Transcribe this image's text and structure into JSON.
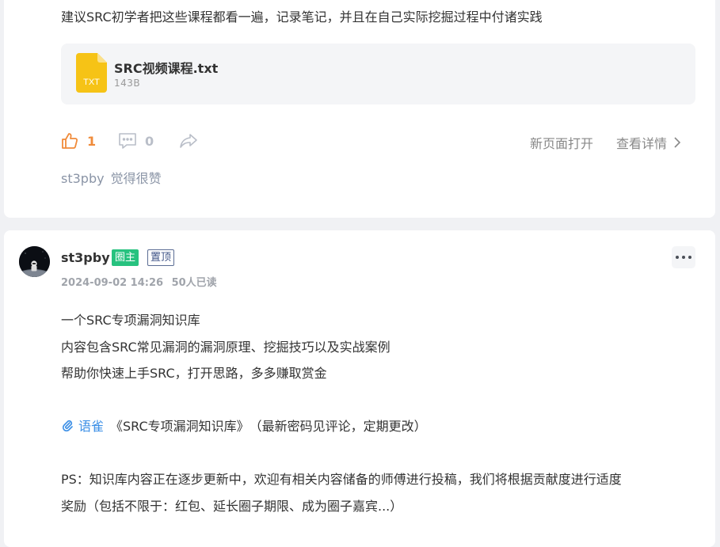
{
  "post1": {
    "text": "建议SRC初学者把这些课程都看一遍，记录笔记，并且在自己实际挖掘过程中付诸实践",
    "attachment": {
      "icon_label": "TXT",
      "name": "SRC视频课程.txt",
      "size": "143B",
      "icon": "txt-file-icon"
    },
    "likes": "1",
    "comments": "0",
    "open_new_page": "新页面打开",
    "view_details": "查看详情",
    "liker_name": "st3pby",
    "liker_text": "觉得很赞",
    "colors": {
      "like": "#f08b3a",
      "comment": "#b9bec8"
    }
  },
  "post2": {
    "author": "st3pby",
    "badge_owner": "圈主",
    "badge_pinned": "置顶",
    "datetime": "2024-09-02 14:26",
    "reads": "50人已读",
    "lines": [
      "一个SRC专项漏洞知识库",
      "内容包含SRC常见漏洞的漏洞原理、挖掘技巧以及实战案例",
      "帮助你快速上手SRC，打开思路，多多赚取赏金"
    ],
    "link_word": "语雀",
    "link_rest": "《SRC专项漏洞知识库》　（最新密码见评论，定期更改）",
    "ps_line1": "PS：知识库内容正在逐步更新中，欢迎有相关内容储备的师傅进行投稿，我们将根据贡献度进行适度",
    "ps_line2": "奖励（包括不限于：红包、延长圈子期限、成为圈子嘉宾...）",
    "colors": {
      "owner_badge": "#27c27f",
      "link": "#3a8ee6"
    }
  }
}
